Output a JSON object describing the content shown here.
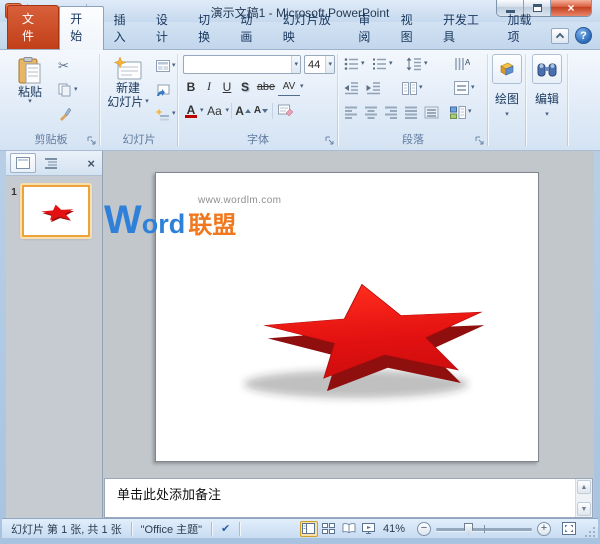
{
  "titlebar": {
    "title": "演示文稿1 - Microsoft PowerPoint"
  },
  "icons": {
    "dropdown": "▾",
    "scissors": "✂",
    "undo": "↶",
    "redo": "↷",
    "close": "×",
    "help": "?",
    "check": "✔",
    "scroll_up": "▲",
    "scroll_down": "▼",
    "zoom_out": "−",
    "zoom_in": "+",
    "app_initial": "P"
  },
  "tabs": [
    {
      "label": "文件"
    },
    {
      "label": "开始"
    },
    {
      "label": "插入"
    },
    {
      "label": "设计"
    },
    {
      "label": "切换"
    },
    {
      "label": "动画"
    },
    {
      "label": "幻灯片放映"
    },
    {
      "label": "审阅"
    },
    {
      "label": "视图"
    },
    {
      "label": "开发工具"
    },
    {
      "label": "加载项"
    }
  ],
  "ribbon": {
    "clipboard": {
      "paste": "粘贴",
      "label": "剪贴板"
    },
    "slides": {
      "new_slide_line1": "新建",
      "new_slide_line2": "幻灯片",
      "label": "幻灯片"
    },
    "font": {
      "size": "44",
      "bold": "B",
      "italic": "I",
      "underline": "U",
      "shadow": "S",
      "strikethrough": "abe",
      "spacing": "AV",
      "color": "A",
      "case": "Aa",
      "grow": "A",
      "shrink": "A",
      "label": "字体"
    },
    "paragraph": {
      "label": "段落"
    },
    "drawing": {
      "label": "绘图"
    },
    "editing": {
      "label": "编辑"
    }
  },
  "slides_panel": {
    "slide_number": "1"
  },
  "canvas": {
    "watermark": {
      "url": "www.wordlm.com",
      "word": "Word",
      "suffix": "联盟"
    }
  },
  "notes": {
    "placeholder": "单击此处添加备注"
  },
  "statusbar": {
    "slide_counter": "幻灯片 第 1 张, 共 1 张",
    "theme": "\"Office 主题\"",
    "zoom_level": "41%"
  },
  "colors": {
    "file_tab": "#C6431C",
    "star_red": "#E31111",
    "star_dark": "#8F0E0E",
    "watermark_blue": "#2F80D8",
    "watermark_orange": "#F0781E",
    "selection_orange": "#ECA33C"
  }
}
